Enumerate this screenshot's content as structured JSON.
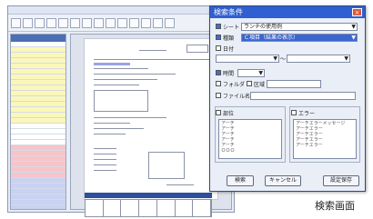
{
  "dialog": {
    "title": "検索条件",
    "rows": [
      {
        "label": "シート",
        "value": "ランチの使用例",
        "checked": true
      },
      {
        "label": "種類",
        "value": "Ｃ項目（結果の表示）",
        "checked": true,
        "selected": true
      },
      {
        "label": "日付",
        "value": "",
        "checked": false
      },
      {
        "label": "時間",
        "value": "",
        "checked": true
      },
      {
        "label": "ファイル名",
        "value": "",
        "checked": false
      }
    ],
    "extra_check_1": "フォルダ",
    "extra_check_2": "区域",
    "list_left_label": "部位",
    "list_left_items": [
      "アーチ",
      "アーチ",
      "アーチ",
      "アーチ",
      "アーチ",
      "ＯＯＯ"
    ],
    "list_right_label": "エラー",
    "list_right_items": [
      "アーチエラーメッセージ",
      "アーチエラー",
      "アーチエラー",
      "アーチエラー",
      "アーチエラー"
    ],
    "buttons": [
      "検索",
      "キャンセル",
      "設定保存"
    ]
  },
  "caption": "検索画面",
  "colors": {
    "titlebar": "#2f5fd0",
    "selection": "#3a66d2",
    "close": "#d9563a"
  }
}
